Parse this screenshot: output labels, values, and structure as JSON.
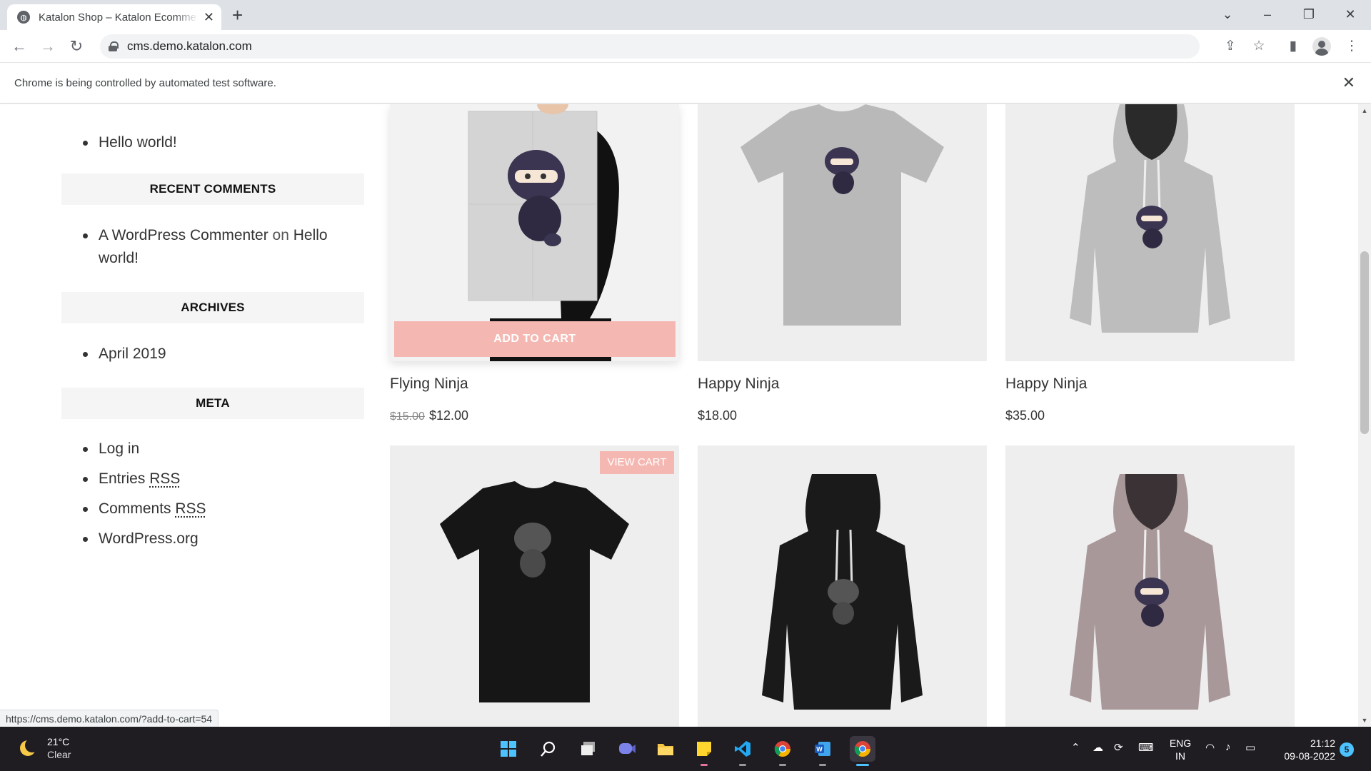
{
  "browser": {
    "tab_title": "Katalon Shop – Katalon Ecommerce",
    "url": "cms.demo.katalon.com",
    "infobar_message": "Chrome is being controlled by automated test software.",
    "status_url": "https://cms.demo.katalon.com/?add-to-cart=54"
  },
  "sidebar": {
    "recent_posts": [
      "Hello world!"
    ],
    "recent_comments_title": "RECENT COMMENTS",
    "recent_comment": {
      "author": "A WordPress Commenter",
      "connector": "on",
      "post_line1": "Hello",
      "post_line2": "world!"
    },
    "archives_title": "ARCHIVES",
    "archives": [
      "April 2019"
    ],
    "meta_title": "META",
    "meta": {
      "login": "Log in",
      "entries": "Entries",
      "comments": "Comments",
      "rss": "RSS",
      "wordpress": "WordPress.org"
    }
  },
  "products": [
    {
      "name": "Flying Ninja",
      "old_price": "$15.00",
      "price": "$12.00"
    },
    {
      "name": "Happy Ninja",
      "price": "$18.00"
    },
    {
      "name": "Happy Ninja",
      "price": "$35.00"
    }
  ],
  "buttons": {
    "add_to_cart": "ADD TO CART",
    "view_cart": "VIEW CART"
  },
  "taskbar": {
    "temperature": "21°C",
    "condition": "Clear",
    "lang_line1": "ENG",
    "lang_line2": "IN",
    "time": "21:12",
    "date": "09-08-2022",
    "notification_count": "5"
  },
  "colors": {
    "accent_pink": "#f5b7b1",
    "widget_bg": "#f5f5f5",
    "taskbar_bg": "#1f1c22"
  }
}
